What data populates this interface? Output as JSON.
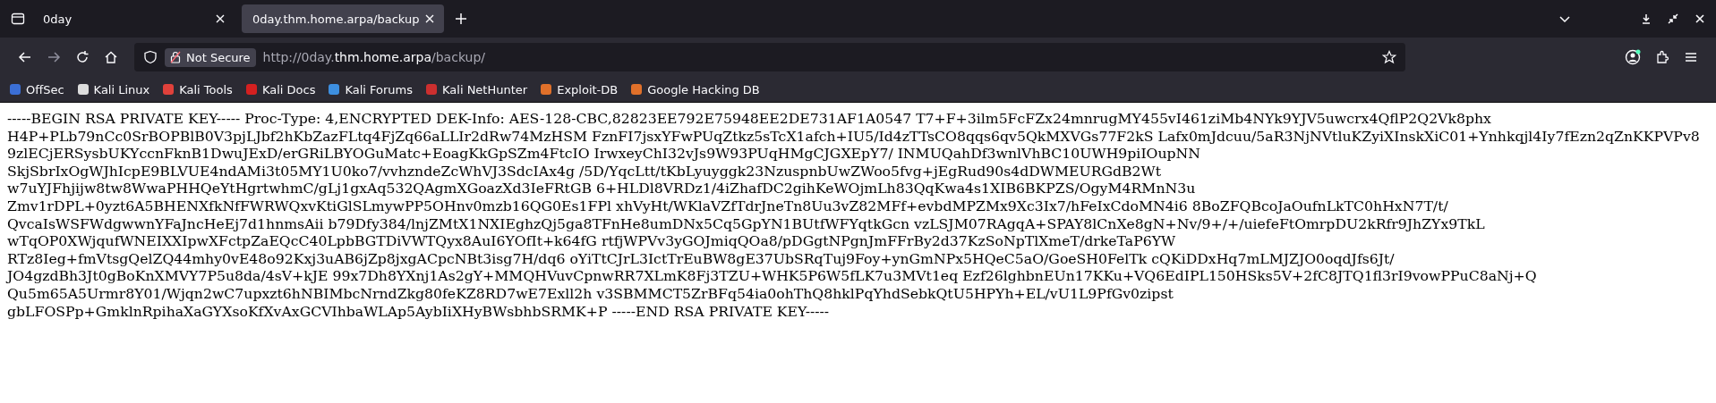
{
  "tabs": [
    {
      "title": "0day",
      "selected": false
    },
    {
      "title": "0day.thm.home.arpa/backup",
      "selected": true
    }
  ],
  "address_bar": {
    "security": "Not Secure",
    "url_prefix": "http://0day.",
    "url_host": "thm.home.arpa",
    "url_path": "/backup/"
  },
  "bookmarks": [
    {
      "label": "OffSec",
      "color": "#3b6fd6"
    },
    {
      "label": "Kali Linux",
      "color": "#dddddd"
    },
    {
      "label": "Kali Tools",
      "color": "#e0413b"
    },
    {
      "label": "Kali Docs",
      "color": "#d42020"
    },
    {
      "label": "Kali Forums",
      "color": "#3d8fe0"
    },
    {
      "label": "Kali NetHunter",
      "color": "#cc2f2f"
    },
    {
      "label": "Exploit-DB",
      "color": "#e0702a"
    },
    {
      "label": "Google Hacking DB",
      "color": "#e0702a"
    }
  ],
  "page_text": "-----BEGIN RSA PRIVATE KEY----- Proc-Type: 4,ENCRYPTED DEK-Info: AES-128-CBC,82823EE792E75948EE2DE731AF1A0547 T7+F+3ilm5FcFZx24mnrugMY455vI461ziMb4NYk9YJV5uwcrx4QflP2Q2Vk8phx H4P+PLb79nCc0SrBOPBlB0V3pjLJbf2hKbZazFLtq4FjZq66aLLIr2dRw74MzHSM FznFI7jsxYFwPUqZtkz5sTcX1afch+IU5/Id4zTTsCO8qqs6qv5QkMXVGs77F2kS Lafx0mJdcuu/5aR3NjNVtluKZyiXInskXiC01+Ynhkqjl4Iy7fEzn2qZnKKPVPv8 9zlECjERSysbUKYccnFknB1DwuJExD/erGRiLBYOGuMatc+EoagKkGpSZm4FtcIO IrwxeyChI32vJs9W93PUqHMgCJGXEpY7/ INMUQahDf3wnlVhBC10UWH9piIOupNN SkjSbrIxOgWJhIcpE9BLVUE4ndAMi3t05MY1U0ko7/vvhzndeZcWhVJ3SdcIAx4g /5D/YqcLtt/tKbLyuyggk23NzuspnbUwZWoo5fvg+jEgRud90s4dDWMEURGdB2Wt w7uYJFhjijw8tw8WwaPHHQeYtHgrtwhmC/gLj1gxAq532QAgmXGoazXd3IeFRtGB 6+HLDl8VRDz1/4iZhafDC2gihKeWOjmLh83QqKwa4s1XIB6BKPZS/OgyM4RMnN3u Zmv1rDPL+0yzt6A5BHENXfkNfFWRWQxvKtiGlSLmywPP5OHnv0mzb16QG0Es1FPl xhVyHt/WKlaVZfTdrJneTn8Uu3vZ82MFf+evbdMPZMx9Xc3Ix7/hFeIxCdoMN4i6 8BoZFQBcoJaOufnLkTC0hHxN7T/t/ QvcaIsWSFWdgwwnYFaJncHeEj7d1hnmsAii b79Dfy384/lnjZMtX1NXIEghzQj5ga8TFnHe8umDNx5Cq5GpYN1BUtfWFYqtkGcn vzLSJM07RAgqA+SPAY8lCnXe8gN+Nv/9+/+/uiefeFtOmrpDU2kRfr9JhZYx9TkL wTqOP0XWjqufWNEIXXIpwXFctpZaEQcC40LpbBGTDiVWTQyx8AuI6YOfIt+k64fG rtfjWPVv3yGOJmiqQOa8/pDGgtNPgnJmFFrBy2d37KzSoNpTlXmeT/drkeTaP6YW RTz8Ieg+fmVtsgQelZQ44mhy0vE48o92Kxj3uAB6jZp8jxgACpcNBt3isg7H/dq6 oYiTtCJrL3IctTrEuBW8gE37UbSRqTuj9Foy+ynGmNPx5HQeC5aO/GoeSH0FelTk cQKiDDxHq7mLMJZJO0oqdJfs6Jt/ JO4gzdBh3Jt0gBoKnXMVY7P5u8da/4sV+kJE 99x7Dh8YXnj1As2gY+MMQHVuvCpnwRR7XLmK8Fj3TZU+WHK5P6W5fLK7u3MVt1eq Ezf26lghbnEUn17KKu+VQ6EdIPL150HSks5V+2fC8JTQ1fl3rI9vowPPuC8aNj+Q Qu5m65A5Urmr8Y01/Wjqn2wC7upxzt6hNBIMbcNrndZkg80feKZ8RD7wE7Exll2h v3SBMMCT5ZrBFq54ia0ohThQ8hklPqYhdSebkQtU5HPYh+EL/vU1L9PfGv0zipst gbLFOSPp+GmklnRpihaXaGYXsoKfXvAxGCVIhbaWLAp5AybIiXHyBWsbhbSRMK+P -----END RSA PRIVATE KEY-----"
}
